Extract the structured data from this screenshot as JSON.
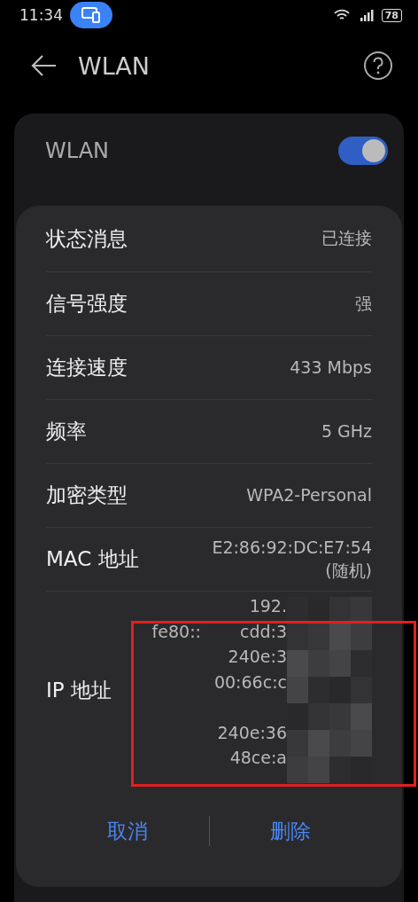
{
  "status_bar": {
    "time": "11:34",
    "battery": "78"
  },
  "header": {
    "title": "WLAN"
  },
  "settings": {
    "label": "WLAN",
    "on": true
  },
  "dialog": {
    "rows": [
      {
        "label": "状态消息",
        "value": [
          "已连接"
        ]
      },
      {
        "label": "信号强度",
        "value": [
          "强"
        ]
      },
      {
        "label": "连接速度",
        "value": [
          "433 Mbps"
        ]
      },
      {
        "label": "频率",
        "value": [
          "5 GHz"
        ]
      },
      {
        "label": "加密类型",
        "value": [
          "WPA2-Personal"
        ]
      },
      {
        "label": "MAC 地址",
        "value": [
          "E2:86:92:DC:E7:54",
          "(随机)"
        ]
      }
    ],
    "ip": {
      "label": "IP 地址",
      "lines": [
        {
          "parts": [
            "192."
          ],
          "gap_above": false
        },
        {
          "parts": [
            "fe80::",
            "cdd:3"
          ],
          "gap_above": false
        },
        {
          "parts": [
            "240e:3"
          ],
          "gap_above": false
        },
        {
          "parts": [
            "00:66c:c"
          ],
          "gap_above": false
        },
        {
          "parts": [
            "240e:36"
          ],
          "gap_above": true
        },
        {
          "parts": [
            "48ce:a"
          ],
          "gap_above": false
        }
      ]
    },
    "buttons": [
      "取消",
      "删除"
    ]
  }
}
